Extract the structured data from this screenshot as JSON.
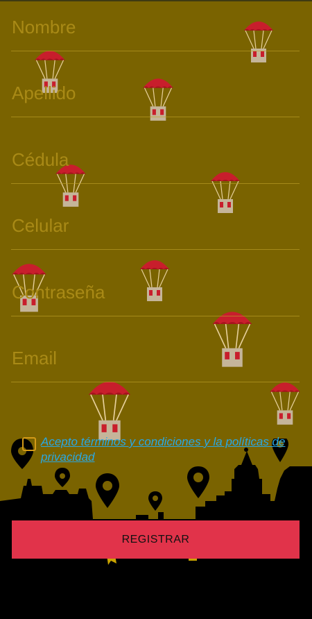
{
  "form": {
    "fields": [
      {
        "placeholder": "Nombre",
        "value": ""
      },
      {
        "placeholder": "Apellido",
        "value": ""
      },
      {
        "placeholder": "Cédula",
        "value": ""
      },
      {
        "placeholder": "Celular",
        "value": ""
      },
      {
        "placeholder": "Contraseña",
        "value": ""
      },
      {
        "placeholder": "Email",
        "value": ""
      }
    ]
  },
  "terms": {
    "checked": false,
    "label": "Acepto términos y condiciones y la políticas de privacidad"
  },
  "register_button": {
    "label": "REGISTRAR"
  },
  "colors": {
    "background": "#7a6300",
    "field_text": "#a98a16",
    "link": "#29a8e4",
    "checkbox": "#d49a18",
    "button": "#e1334a",
    "skyline": "#000000"
  },
  "decorations": {
    "icon": "parachute-gift-icon",
    "map_icon": "map-pin-icon"
  }
}
